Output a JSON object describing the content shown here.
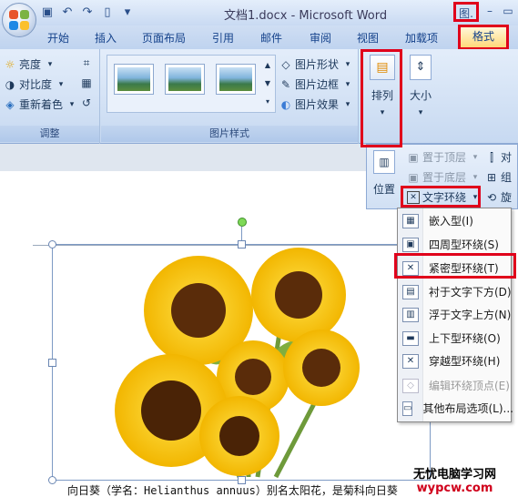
{
  "window": {
    "title": "文档1.docx - Microsoft Word",
    "picture_tools_label": "图.",
    "minimize": "–",
    "restore": "▭"
  },
  "tabs": [
    "开始",
    "插入",
    "页面布局",
    "引用",
    "邮件",
    "审阅",
    "视图",
    "加载项"
  ],
  "active_tab": "格式",
  "adjust_group": {
    "label": "调整",
    "brightness": "亮度",
    "contrast": "对比度",
    "recolor": "重新着色"
  },
  "picture_styles_group": {
    "label": "图片样式",
    "shape": "图片形状",
    "border": "图片边框",
    "effects": "图片效果"
  },
  "arrange_button": "排列",
  "size_button": "大小",
  "arrange_panel": {
    "bring_front": "置于顶层",
    "send_back": "置于底层",
    "position": "位置",
    "text_wrap": "文字环绕",
    "align": "对",
    "group": "组",
    "rotate": "旋"
  },
  "wrap_menu": [
    {
      "label": "嵌入型(I)",
      "disabled": false
    },
    {
      "label": "四周型环绕(S)",
      "disabled": false
    },
    {
      "label": "紧密型环绕(T)",
      "disabled": false
    },
    {
      "label": "衬于文字下方(D)",
      "disabled": false
    },
    {
      "label": "浮于文字上方(N)",
      "disabled": false
    },
    {
      "label": "上下型环绕(O)",
      "disabled": false
    },
    {
      "label": "穿越型环绕(H)",
      "disabled": false
    },
    {
      "label": "编辑环绕顶点(E)",
      "disabled": true
    },
    {
      "label": "其他布局选项(L)...",
      "disabled": false
    }
  ],
  "document": {
    "caption": "向日葵（学名：Helianthus annuus）别名太阳花，是菊科向日葵"
  },
  "watermark": {
    "line1": "无忧电脑学习网",
    "line2": "wypcw.com"
  },
  "colors": {
    "highlight": "#e0001b",
    "ribbon": "#c7d9f1"
  }
}
